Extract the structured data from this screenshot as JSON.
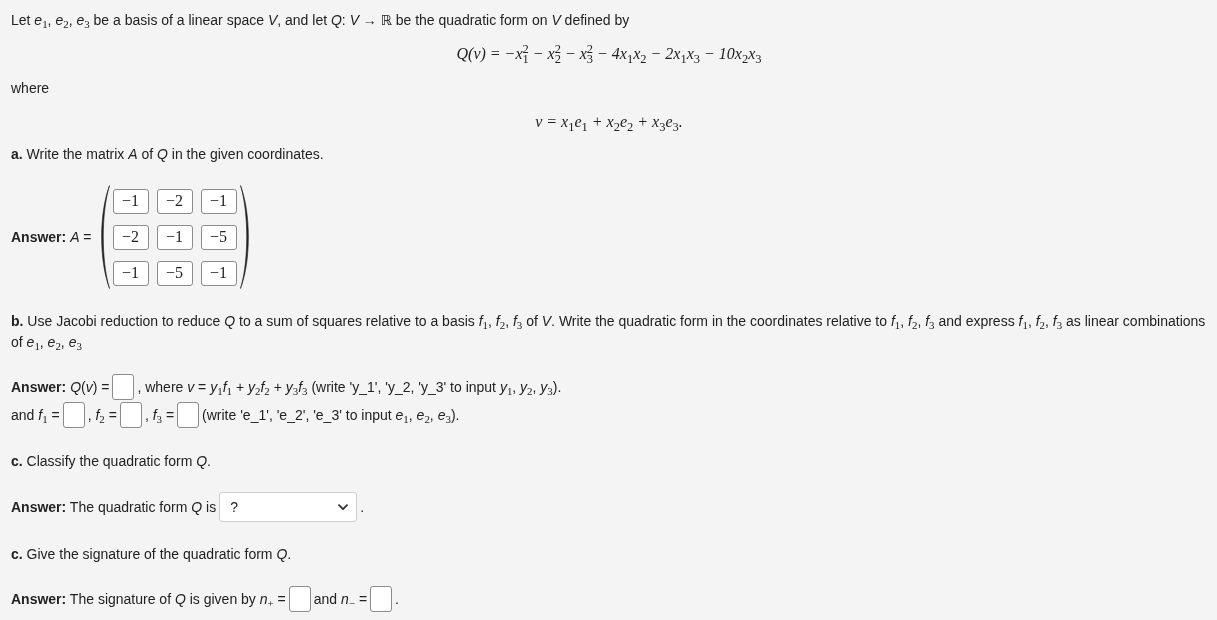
{
  "preamble": [
    {
      "kind": "text",
      "text": "Let *e*$_{1}$, *e*$_{2}$, *e*$_{3}$ be a basis of a linear space *V*, and let *Q*: *V* → ℝ be the quadratic form on *V* defined by"
    },
    {
      "kind": "formula",
      "text": "Q(v) = −x$_{1}$$^{2}$ − x$_{2}$$^{2}$ − x$_{3}$$^{2}$ − 4x$_{1}$x$_{2}$ − 2x$_{1}$x$_{3}$ − 10x$_{2}$x$_{3}$"
    },
    {
      "kind": "text",
      "text": "where"
    },
    {
      "kind": "formula",
      "text": "v = x$_{1}$e$_{1}$ + x$_{2}$e$_{2}$ + x$_{3}$e$_{3}$."
    }
  ],
  "parts": [
    {
      "prompt": "**a.** Write the matrix *A* of *Q* in the given coordinates.",
      "answer_lines": [
        [
          {
            "kind": "text",
            "text": "**Answer:** *A* ="
          },
          {
            "kind": "matrix",
            "rows": [
              [
                "−1",
                "−2",
                "−1"
              ],
              [
                "−2",
                "−1",
                "−5"
              ],
              [
                "−1",
                "−5",
                "−1"
              ]
            ]
          }
        ]
      ]
    },
    {
      "prompt": "**b.** Use Jacobi reduction to reduce *Q* to a sum of squares relative to a basis *f*$_{1}$, *f*$_{2}$, *f*$_{3}$ of *V*. Write the quadratic form in the coordinates relative to *f*$_{1}$, *f*$_{2}$, *f*$_{3}$ and express *f*$_{1}$, *f*$_{2}$, *f*$_{3}$ as linear combinations of *e*$_{1}$, *e*$_{2}$, *e*$_{3}$",
      "answer_lines": [
        [
          {
            "kind": "text",
            "text": "**Answer:** *Q*(*v*) ="
          },
          {
            "kind": "field"
          },
          {
            "kind": "text",
            "text": ", where *v* = *y*$_{1}$*f*$_{1}$ + *y*$_{2}$*f*$_{2}$ + *y*$_{3}$*f*$_{3}$ (write 'y_1', 'y_2, 'y_3' to input *y*$_{1}$, *y*$_{2}$, *y*$_{3}$)."
          }
        ],
        [
          {
            "kind": "text",
            "text": "and *f*$_{1}$ ="
          },
          {
            "kind": "field"
          },
          {
            "kind": "text",
            "text": ", *f*$_{2}$ ="
          },
          {
            "kind": "field"
          },
          {
            "kind": "text",
            "text": ", *f*$_{3}$ ="
          },
          {
            "kind": "field"
          },
          {
            "kind": "text",
            "text": "(write 'e_1', 'e_2', 'e_3' to input *e*$_{1}$, *e*$_{2}$, *e*$_{3}$)."
          }
        ]
      ]
    },
    {
      "prompt": "**c.** Classify the quadratic form *Q*.",
      "answer_lines": [
        [
          {
            "kind": "text",
            "text": "**Answer:** The quadratic form *Q* is"
          },
          {
            "kind": "select",
            "value": "?"
          },
          {
            "kind": "text",
            "text": "."
          }
        ]
      ]
    },
    {
      "prompt": "**c.** Give the signature of the quadratic form *Q*.",
      "answer_lines": [
        [
          {
            "kind": "text",
            "text": "**Answer:** The signature of *Q* is given by *n*$_{+}$ ="
          },
          {
            "kind": "field"
          },
          {
            "kind": "text",
            "text": "and *n*$_{−}$ ="
          },
          {
            "kind": "field"
          },
          {
            "kind": "text",
            "text": "."
          }
        ]
      ]
    }
  ]
}
